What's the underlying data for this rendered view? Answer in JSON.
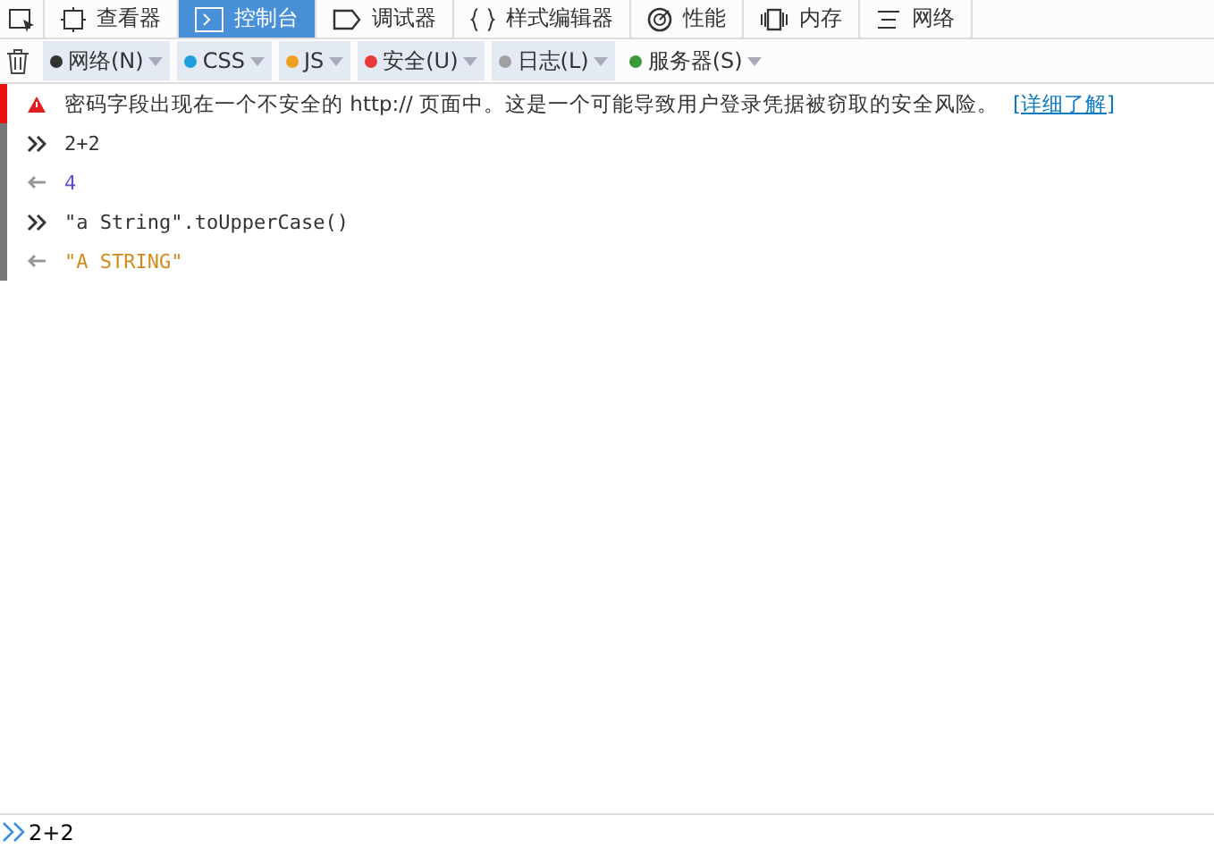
{
  "tabs": [
    {
      "label": "查看器",
      "kind": "inspector",
      "selected": false
    },
    {
      "label": "控制台",
      "kind": "console",
      "selected": true
    },
    {
      "label": "调试器",
      "kind": "debugger",
      "selected": false
    },
    {
      "label": "样式编辑器",
      "kind": "braces",
      "selected": false
    },
    {
      "label": "性能",
      "kind": "performance",
      "selected": false
    },
    {
      "label": "内存",
      "kind": "memory",
      "selected": false
    },
    {
      "label": "网络",
      "kind": "network",
      "selected": false
    }
  ],
  "filters": [
    {
      "label": "网络(N)",
      "color": "#333333",
      "selected": true
    },
    {
      "label": "CSS",
      "color": "#1ea0e0",
      "selected": true
    },
    {
      "label": "JS",
      "color": "#f0a020",
      "selected": true
    },
    {
      "label": "安全(U)",
      "color": "#e83838",
      "selected": true
    },
    {
      "label": "日志(L)",
      "color": "#a0a0a0",
      "selected": true
    },
    {
      "label": "服务器(S)",
      "color": "#3a9a3a",
      "selected": false
    }
  ],
  "messages": [
    {
      "kind": "warning",
      "text": "密码字段出现在一个不安全的 http:// 页面中。这是一个可能导致用户登录凭据被窃取的安全风险。",
      "link": "[详细了解]"
    },
    {
      "kind": "input",
      "text": "2+2"
    },
    {
      "kind": "number",
      "text": "4"
    },
    {
      "kind": "input",
      "text": "\"a String\".toUpperCase()"
    },
    {
      "kind": "string",
      "text": "\"A STRING\""
    }
  ],
  "input": {
    "value": "2+2"
  }
}
